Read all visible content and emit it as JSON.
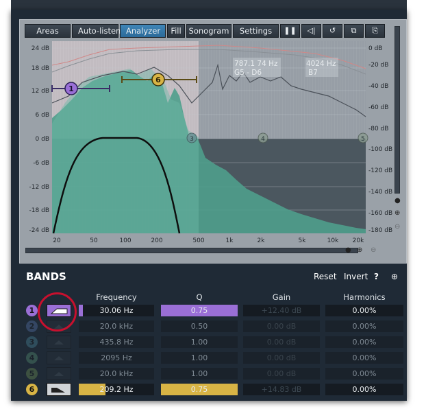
{
  "toolbar": {
    "areas": "Areas",
    "autolisten": "Auto-listen",
    "analyzer": "Analyzer",
    "fill": "Fill",
    "sonogram": "Sonogram",
    "settings": "Settings",
    "pause_glyph": "❚❚",
    "speaker_glyph": "◁|",
    "undo_glyph": "↺",
    "copy_glyph": "⧉",
    "paste_glyph": "⎘"
  },
  "graph": {
    "left_db_labels": [
      "24 dB",
      "18 dB",
      "12 dB",
      "6 dB",
      "0 dB",
      "-6 dB",
      "-12 dB",
      "-18 dB",
      "-24 dB"
    ],
    "right_db_labels": [
      "0 dB",
      "-20 dB",
      "-40 dB",
      "-60 dB",
      "-80 dB",
      "-100 dB",
      "-120 dB",
      "-140 dB",
      "-160 dB",
      "-180 dB"
    ],
    "freq_labels": [
      "20",
      "50",
      "100",
      "200",
      "500",
      "1k",
      "2k",
      "5k",
      "10k",
      "20k"
    ],
    "readout_1_line1": "787.1 74 Hz",
    "readout_1_line2": "G5 - D6",
    "readout_2_line1": "4024 Hz",
    "readout_2_line2": "B7",
    "markers": [
      "1",
      "6",
      "3",
      "4",
      "5"
    ],
    "colors": {
      "spectrum_fill": "#4f9e8c",
      "analyzer_bg": "#9ba2a9",
      "band1": "#9a6fd6",
      "band6": "#d8b445"
    }
  },
  "bands": {
    "title": "BANDS",
    "reset": "Reset",
    "invert": "Invert",
    "help": "?",
    "menu_glyph": "⊕",
    "headers": {
      "frequency": "Frequency",
      "q": "Q",
      "gain": "Gain",
      "harmonics": "Harmonics"
    },
    "rows": [
      {
        "num": "1",
        "frequency": "30.06 Hz",
        "q": "0.75",
        "gain": "+12.40 dB",
        "harmonics": "0.00%",
        "active": true,
        "color": "#9a6fd6",
        "freq_fill": 0.05,
        "q_fill": 1.0
      },
      {
        "num": "2",
        "frequency": "20.0 kHz",
        "q": "0.50",
        "gain": "0.00 dB",
        "harmonics": "0.00%",
        "active": false,
        "color": "#6a8fd6",
        "freq_fill": 0.9,
        "q_fill": 0.3
      },
      {
        "num": "3",
        "frequency": "435.8 Hz",
        "q": "1.00",
        "gain": "0.00 dB",
        "harmonics": "0.00%",
        "active": false,
        "color": "#5aa9c0",
        "freq_fill": 0.45,
        "q_fill": 0.4
      },
      {
        "num": "4",
        "frequency": "2095 Hz",
        "q": "1.00",
        "gain": "0.00 dB",
        "harmonics": "0.00%",
        "active": false,
        "color": "#6ab88a",
        "freq_fill": 0.65,
        "q_fill": 0.4
      },
      {
        "num": "5",
        "frequency": "20.0 kHz",
        "q": "1.00",
        "gain": "0.00 dB",
        "harmonics": "0.00%",
        "active": false,
        "color": "#8ab860",
        "freq_fill": 0.9,
        "q_fill": 0.4
      },
      {
        "num": "6",
        "frequency": "209.2 Hz",
        "q": "0.75",
        "gain": "+14.83 dB",
        "harmonics": "0.00%",
        "active": true,
        "color": "#d8b445",
        "freq_fill": 0.35,
        "q_fill": 1.0
      }
    ]
  }
}
